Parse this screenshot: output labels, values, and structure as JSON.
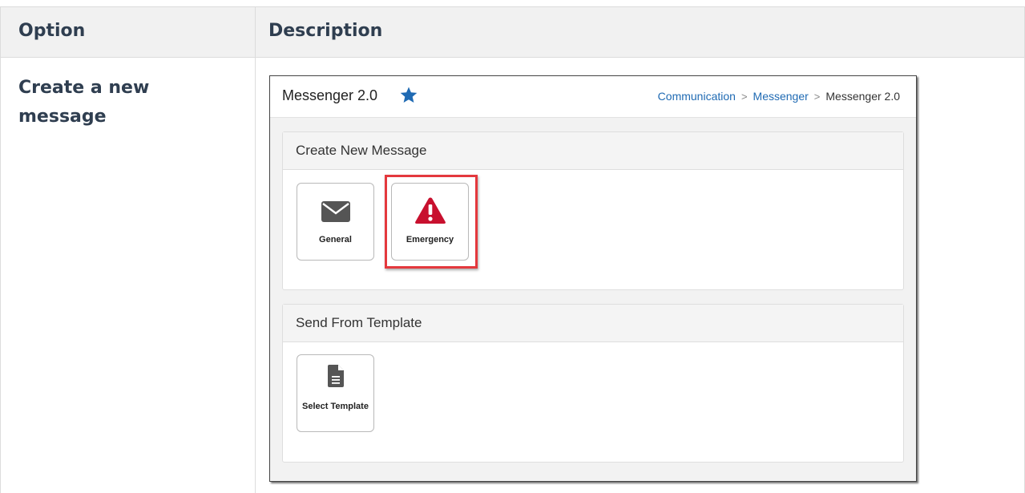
{
  "table": {
    "headers": {
      "option": "Option",
      "description": "Description"
    },
    "rows": [
      {
        "option": "Create a new message"
      }
    ]
  },
  "screenshot": {
    "app_title": "Messenger 2.0",
    "breadcrumb": [
      "Communication",
      "Messenger",
      "Messenger 2.0"
    ],
    "panels": {
      "create": {
        "title": "Create New Message",
        "tiles": [
          {
            "label": "General",
            "icon": "envelope-icon"
          },
          {
            "label": "Emergency",
            "icon": "warning-icon",
            "highlighted": true
          }
        ]
      },
      "template": {
        "title": "Send From Template",
        "tiles": [
          {
            "label": "Select Template",
            "icon": "document-icon"
          }
        ]
      }
    },
    "colors": {
      "star": "#1f6ab3",
      "link": "#1f6ab3",
      "emergency": "#c8102e",
      "highlight": "#e4383d"
    }
  }
}
